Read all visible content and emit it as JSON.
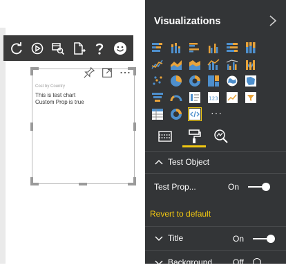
{
  "toolbar": {
    "buttons": [
      {
        "icon": "refresh-icon"
      },
      {
        "icon": "play-icon"
      },
      {
        "icon": "dataview-icon"
      },
      {
        "icon": "export-icon"
      },
      {
        "icon": "help-icon"
      },
      {
        "icon": "smiley-icon"
      }
    ]
  },
  "visual": {
    "title": "Cost by Country",
    "line1": "This is test chart",
    "line2": "Custom Prop is true"
  },
  "pane": {
    "title": "Visualizations",
    "more_label": "···",
    "sections": {
      "test_object": "Test Object",
      "test_prop_label": "Test Prop...",
      "test_prop_value": "On",
      "revert": "Revert to default",
      "title_label": "Title",
      "title_value": "On",
      "background_label": "Background",
      "background_value": "Off"
    }
  },
  "colors": {
    "pane_bg": "#333537",
    "accent": "#f2c811",
    "icon_orange": "#e8a33a",
    "icon_blue": "#4e8fcc"
  }
}
